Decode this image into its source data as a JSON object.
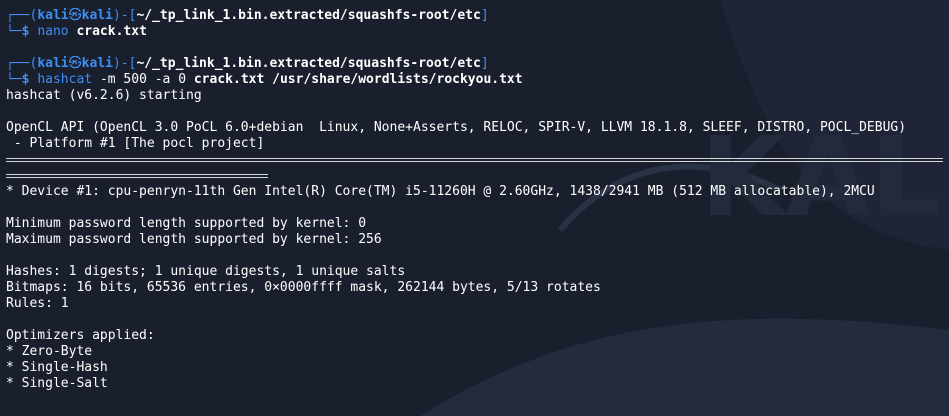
{
  "colors": {
    "background": "#1a1f2e",
    "prompt_blue": "#3f8ef0",
    "text": "#ffffff"
  },
  "prompt": {
    "user": "kali",
    "skull": "㉿",
    "host": "kali",
    "path": "~/_tp_link_1.bin.extracted/squashfs-root/etc",
    "symbol": "$"
  },
  "commands": [
    {
      "cmd": "nano",
      "args": [
        {
          "t": "crack.txt",
          "bold": true
        }
      ]
    },
    {
      "cmd": "hashcat",
      "args": [
        {
          "t": "-m 500 -a 0",
          "bold": false
        },
        {
          "t": "crack.txt /usr/share/wordlists/rockyou.txt",
          "bold": true
        }
      ]
    }
  ],
  "output": {
    "start": "hashcat (v6.2.6) starting",
    "opencl": "OpenCL API (OpenCL 3.0 PoCL 6.0+debian  Linux, None+Asserts, RELOC, SPIR-V, LLVM 18.1.8, SLEEF, DISTRO, POCL_DEBUG)",
    "platform": " - Platform #1 [The pocl project]",
    "device": "* Device #1: cpu-penryn-11th Gen Intel(R) Core(TM) i5-11260H @ 2.60GHz, 1438/2941 MB (512 MB allocatable), 2MCU",
    "min_pw": "Minimum password length supported by kernel: 0",
    "max_pw": "Maximum password length supported by kernel: 256",
    "hashes": "Hashes: 1 digests; 1 unique digests, 1 unique salts",
    "bitmaps": "Bitmaps: 16 bits, 65536 entries, 0×0000ffff mask, 262144 bytes, 5/13 rotates",
    "rules": "Rules: 1",
    "optimizers_header": "Optimizers applied:",
    "optimizers": [
      "* Zero-Byte",
      "* Single-Hash",
      "* Single-Salt"
    ]
  }
}
